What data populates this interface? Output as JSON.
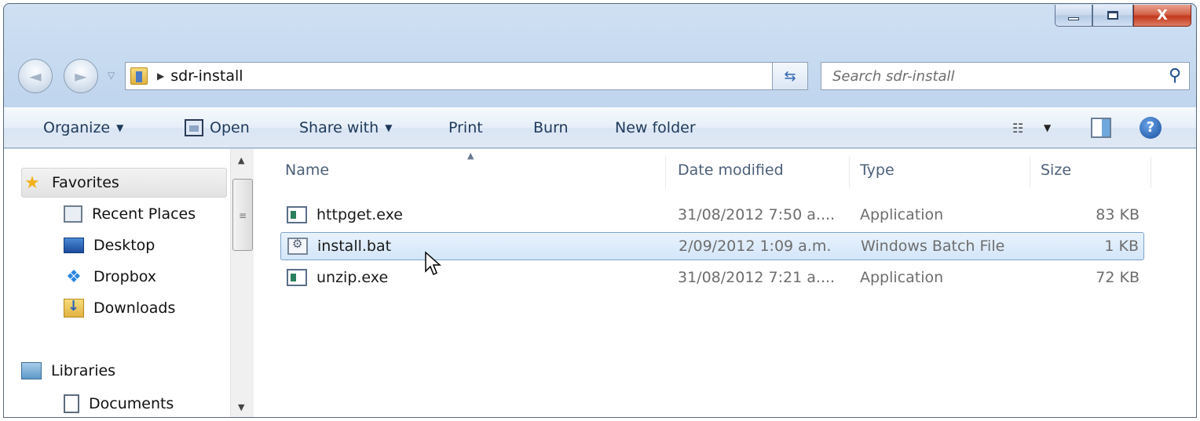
{
  "window": {
    "caption_buttons": {
      "minimize_icon": "minimize-icon",
      "maximize_icon": "maximize-icon",
      "close_icon": "close-icon"
    },
    "close_label": "X",
    "close_color": "#c2381c"
  },
  "navigation": {
    "back_glyph": "◄",
    "forward_glyph": "►",
    "breadcrumb": [
      "sdr-install"
    ],
    "search": {
      "placeholder": "Search sdr-install",
      "value": ""
    }
  },
  "command_bar": {
    "organize": "Organize",
    "open": "Open",
    "share_with": "Share with",
    "print": "Print",
    "burn": "Burn",
    "new_folder": "New folder",
    "help_glyph": "?"
  },
  "nav_pane": {
    "favorites": {
      "label": "Favorites",
      "items": [
        {
          "label": "Recent Places",
          "icon": "recent-places-icon"
        },
        {
          "label": "Desktop",
          "icon": "desktop-icon"
        },
        {
          "label": "Dropbox",
          "icon": "dropbox-icon"
        },
        {
          "label": "Downloads",
          "icon": "downloads-icon"
        }
      ]
    },
    "libraries": {
      "label": "Libraries",
      "items": [
        {
          "label": "Documents",
          "icon": "documents-icon"
        }
      ]
    }
  },
  "file_list": {
    "columns": [
      "Name",
      "Date modified",
      "Type",
      "Size"
    ],
    "sort_column": "Name",
    "rows": [
      {
        "name": "httpget.exe",
        "date": "31/08/2012 7:50 a....",
        "type": "Application",
        "size": "83 KB",
        "selected": false
      },
      {
        "name": "install.bat",
        "date": "2/09/2012 1:09 a.m.",
        "type": "Windows Batch File",
        "size": "1 KB",
        "selected": true
      },
      {
        "name": "unzip.exe",
        "date": "31/08/2012 7:21 a....",
        "type": "Application",
        "size": "72 KB",
        "selected": false
      }
    ]
  },
  "colors": {
    "accent": "#1e395b",
    "selection": "#d3e6fa",
    "window_frame": "#bcd3ec"
  }
}
